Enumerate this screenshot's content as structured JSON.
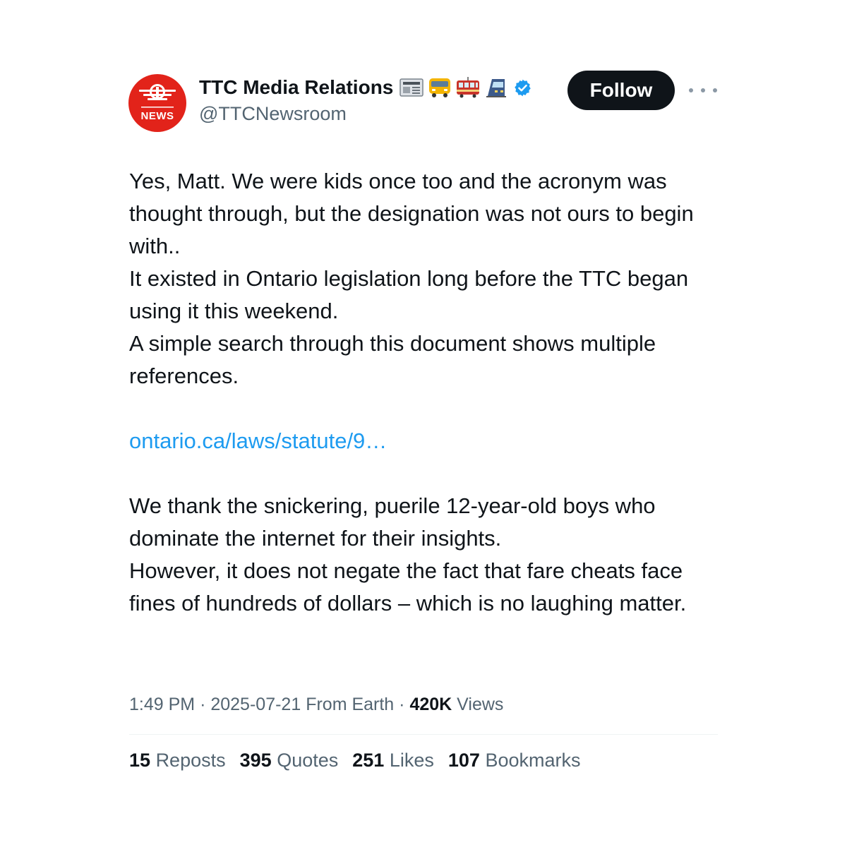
{
  "author": {
    "display_name": "TTC Media Relations",
    "handle": "@TTCNewsroom",
    "avatar_label": "NEWS",
    "verified": true,
    "name_emojis": [
      "newspaper-emoji",
      "bus-emoji",
      "streetcar-emoji",
      "subway-train-emoji"
    ]
  },
  "actions": {
    "follow_label": "Follow"
  },
  "tweet": {
    "lines": [
      "Yes, Matt. We were kids once too and the acronym was thought through, but the designation was not ours to begin with..",
      "It existed in Ontario legislation long before the TTC began using it this weekend.",
      "A simple search through this document shows multiple references."
    ],
    "link": "ontario.ca/laws/statute/9…",
    "lines_after": [
      "We thank the snickering, puerile 12-year-old boys who dominate the internet for their insights.",
      "However, it does not negate the fact that fare cheats face fines of hundreds of dollars – which is no laughing matter."
    ]
  },
  "meta": {
    "time": "1:49 PM",
    "date": "2025-07-21",
    "source": "From Earth",
    "views_count": "420K",
    "views_label": "Views"
  },
  "stats": [
    {
      "count": "15",
      "label": "Reposts"
    },
    {
      "count": "395",
      "label": "Quotes"
    },
    {
      "count": "251",
      "label": "Likes"
    },
    {
      "count": "107",
      "label": "Bookmarks"
    }
  ],
  "colors": {
    "text": "#0f1419",
    "secondary": "#536471",
    "link": "#1d9bf0",
    "brand_red": "#e2231a",
    "verified_blue": "#1d9bf0"
  }
}
